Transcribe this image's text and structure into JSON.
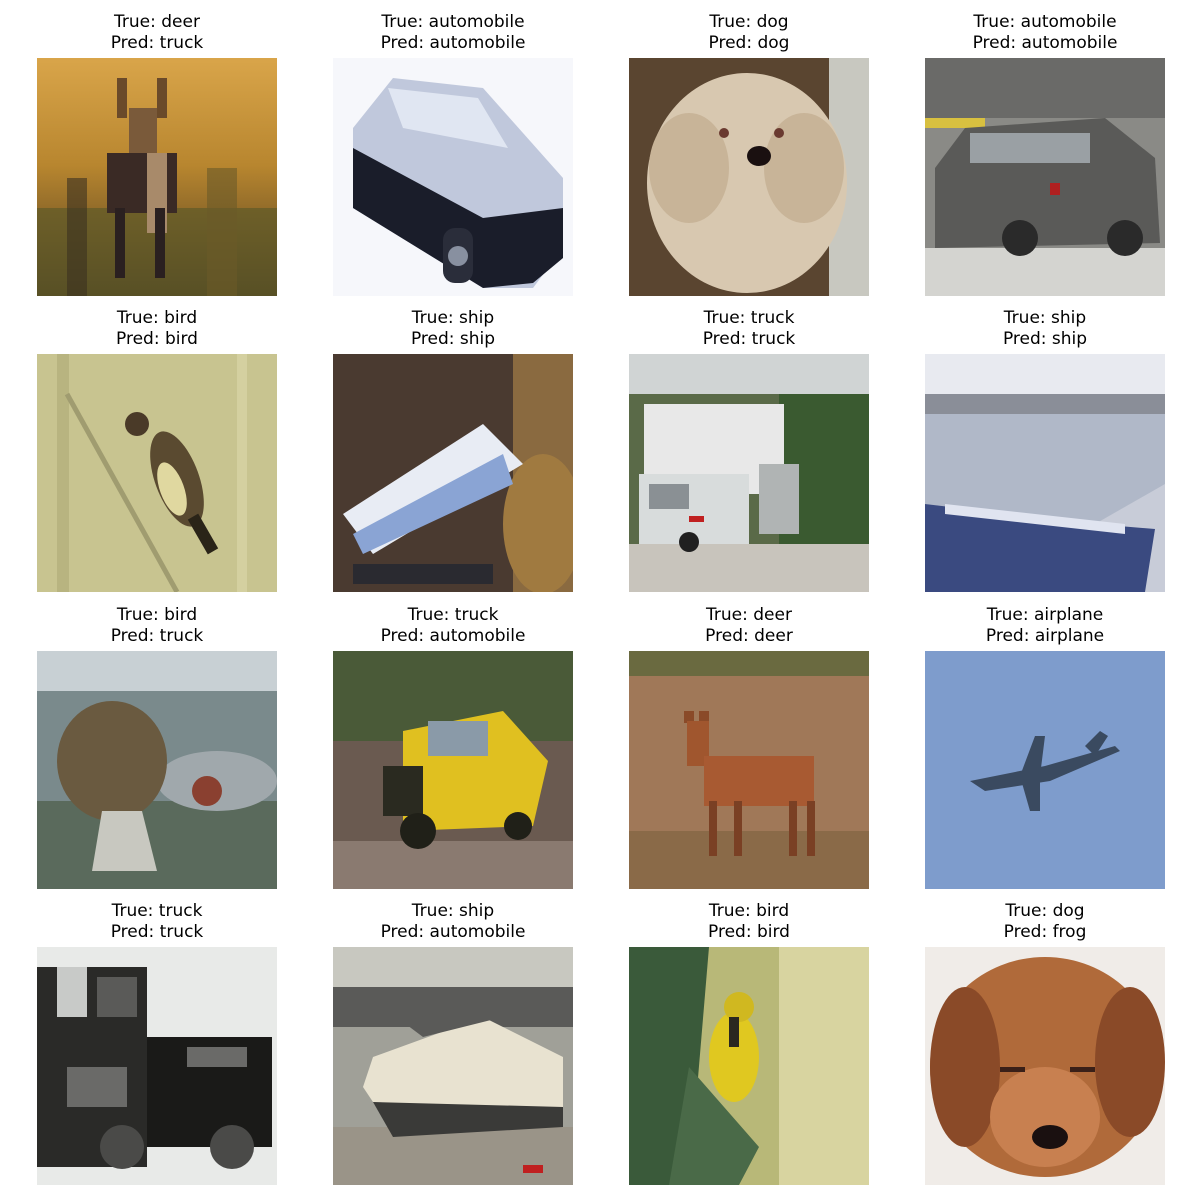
{
  "grid": {
    "panels": [
      {
        "true_label": "True: deer",
        "pred_label": "Pred: truck",
        "subject": "deer standing in golden grass"
      },
      {
        "true_label": "True: automobile",
        "pred_label": "Pred: automobile",
        "subject": "dark car on white background"
      },
      {
        "true_label": "True: dog",
        "pred_label": "Pred: dog",
        "subject": "fluffy cream-coloured puppy"
      },
      {
        "true_label": "True: automobile",
        "pred_label": "Pred: automobile",
        "subject": "grey car on street"
      },
      {
        "true_label": "True: bird",
        "pred_label": "Pred: bird",
        "subject": "small bird perched on reed"
      },
      {
        "true_label": "True: ship",
        "pred_label": "Pred: ship",
        "subject": "white boat with sign"
      },
      {
        "true_label": "True: truck",
        "pred_label": "Pred: truck",
        "subject": "white box truck by trees"
      },
      {
        "true_label": "True: ship",
        "pred_label": "Pred: ship",
        "subject": "ship hull at dock"
      },
      {
        "true_label": "True: bird",
        "pred_label": "Pred: truck",
        "subject": "bird on post near vehicle"
      },
      {
        "true_label": "True: truck",
        "pred_label": "Pred: automobile",
        "subject": "yellow utility vehicle"
      },
      {
        "true_label": "True: deer",
        "pred_label": "Pred: deer",
        "subject": "deer in brown field"
      },
      {
        "true_label": "True: airplane",
        "pred_label": "Pred: airplane",
        "subject": "airplane in blue sky"
      },
      {
        "true_label": "True: truck",
        "pred_label": "Pred: truck",
        "subject": "black and white truck"
      },
      {
        "true_label": "True: ship",
        "pred_label": "Pred: automobile",
        "subject": "white speedboat on road"
      },
      {
        "true_label": "True: bird",
        "pred_label": "Pred: bird",
        "subject": "yellow bird on branch"
      },
      {
        "true_label": "True: dog",
        "pred_label": "Pred: frog",
        "subject": "brown puppy lying down"
      }
    ]
  }
}
